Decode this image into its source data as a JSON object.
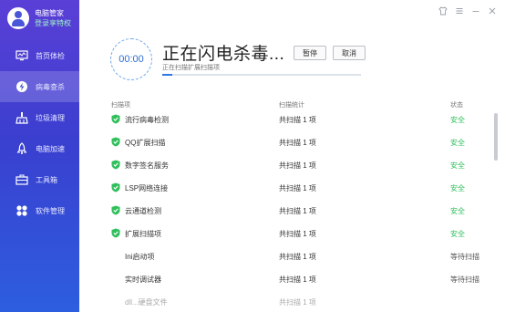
{
  "profile": {
    "name": "电脑管家",
    "link": "登录享特权"
  },
  "nav": [
    {
      "label": "首页体检",
      "icon": "monitor-icon",
      "active": false
    },
    {
      "label": "病毒查杀",
      "icon": "lightning-icon",
      "active": true
    },
    {
      "label": "垃圾清理",
      "icon": "broom-icon",
      "active": false
    },
    {
      "label": "电脑加速",
      "icon": "rocket-icon",
      "active": false
    },
    {
      "label": "工具箱",
      "icon": "toolbox-icon",
      "active": false
    },
    {
      "label": "软件管理",
      "icon": "apps-icon",
      "active": false
    }
  ],
  "header": {
    "timer": "00:00",
    "title": "正在闪电杀毒...",
    "pause": "暂停",
    "cancel": "取消",
    "subtitle": "正在扫描扩展扫描项",
    "progress": 0.05
  },
  "table": {
    "columns": [
      "扫描项",
      "扫描统计",
      "状态"
    ],
    "rows": [
      {
        "name": "流行病毒检测",
        "stat": "共扫描 1 项",
        "status": "安全",
        "checked": true
      },
      {
        "name": "QQ扩展扫描",
        "stat": "共扫描 1 项",
        "status": "安全",
        "checked": true
      },
      {
        "name": "数字签名服务",
        "stat": "共扫描 1 项",
        "status": "安全",
        "checked": true
      },
      {
        "name": "LSP网络连接",
        "stat": "共扫描 1 项",
        "status": "安全",
        "checked": true
      },
      {
        "name": "云通道检测",
        "stat": "共扫描 1 项",
        "status": "安全",
        "checked": true
      },
      {
        "name": "扩展扫描项",
        "stat": "共扫描 1 项",
        "status": "安全",
        "checked": true
      },
      {
        "name": "Ini启动项",
        "stat": "共扫描 1 项",
        "status": "等待扫描",
        "checked": false
      },
      {
        "name": "实时调试器",
        "stat": "共扫描 1 项",
        "status": "等待扫描",
        "checked": false
      },
      {
        "name": "dll...硬盘文件",
        "stat": "共扫描 1 项",
        "status": "",
        "checked": false,
        "faded": true
      }
    ]
  },
  "colors": {
    "safe": "#2fbf5b",
    "accent": "#2c78e4",
    "sidebar_top": "#5b3fd6",
    "sidebar_bottom": "#2d5ee0"
  }
}
